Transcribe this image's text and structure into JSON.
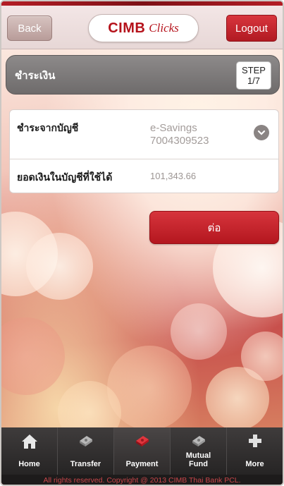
{
  "header": {
    "back_label": "Back",
    "logo_main": "CIMB",
    "logo_sub": "Clicks",
    "logout_label": "Logout"
  },
  "step_bar": {
    "title": "ชำระเงิน",
    "step_label": "STEP",
    "step_value": "1/7"
  },
  "form": {
    "from_account_label": "ชำระจากบัญชี",
    "account_type": "e-Savings",
    "account_number": "7004309523",
    "available_balance_label": "ยอดเงินในบัญชีที่ใช้ได้",
    "available_balance": "101,343.66"
  },
  "next_button_label": "ต่อ",
  "nav": {
    "items": [
      {
        "label": "Home",
        "icon": "home-icon"
      },
      {
        "label": "Transfer",
        "icon": "transfer-icon"
      },
      {
        "label": "Payment",
        "icon": "payment-icon"
      },
      {
        "label": "Mutual Fund",
        "icon": "mutual-fund-icon"
      },
      {
        "label": "More",
        "icon": "plus-icon"
      }
    ],
    "active_index": 2
  },
  "footer_text": "All rights reserved. Copyright @ 2013 CIMB Thai Bank PCL.",
  "colors": {
    "brand_red": "#b5121b",
    "step_bar_gray": "#7c7979",
    "nav_dark": "#2f2d2d"
  }
}
